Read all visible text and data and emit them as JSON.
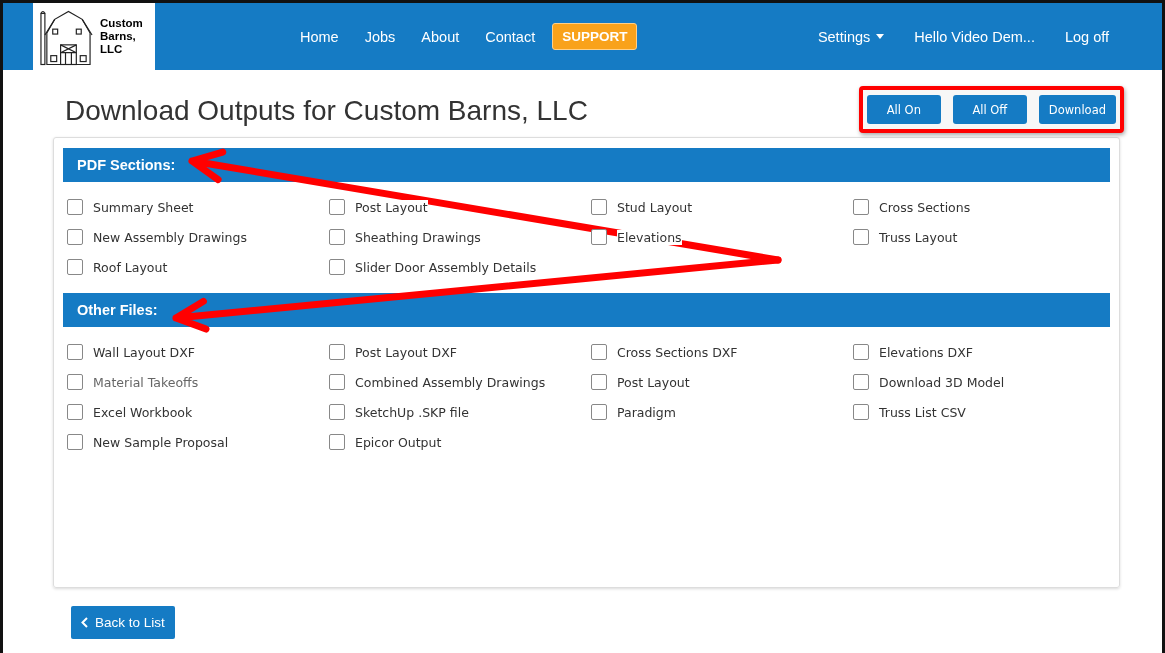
{
  "logo": {
    "text": "Custom Barns, LLC"
  },
  "nav": {
    "links": [
      {
        "label": "Home",
        "kind": "link"
      },
      {
        "label": "Jobs",
        "kind": "link"
      },
      {
        "label": "About",
        "kind": "link"
      },
      {
        "label": "Contact",
        "kind": "link"
      },
      {
        "label": "SUPPORT",
        "kind": "highlight"
      }
    ],
    "right": [
      {
        "label": "Settings",
        "kind": "dropdown"
      },
      {
        "label": "Hello Video Dem...",
        "kind": "link"
      },
      {
        "label": "Log off",
        "kind": "link"
      }
    ]
  },
  "title": "Download Outputs for Custom Barns, LLC",
  "actions": [
    "All On",
    "All Off",
    "Download"
  ],
  "sections": [
    {
      "title": "PDF Sections:",
      "items": [
        {
          "label": "Summary Sheet",
          "checked": false,
          "disabled": false
        },
        {
          "label": "Post Layout",
          "checked": false,
          "disabled": false
        },
        {
          "label": "Stud Layout",
          "checked": false,
          "disabled": false
        },
        {
          "label": "Cross Sections",
          "checked": false,
          "disabled": false
        },
        {
          "label": "New Assembly Drawings",
          "checked": false,
          "disabled": false
        },
        {
          "label": "Sheathing Drawings",
          "checked": false,
          "disabled": false
        },
        {
          "label": "Elevations",
          "checked": false,
          "disabled": false
        },
        {
          "label": "Truss Layout",
          "checked": false,
          "disabled": false
        },
        {
          "label": "Roof Layout",
          "checked": false,
          "disabled": false
        },
        {
          "label": "Slider Door Assembly Details",
          "checked": false,
          "disabled": false
        }
      ]
    },
    {
      "title": "Other Files:",
      "items": [
        {
          "label": "Wall Layout DXF",
          "checked": false,
          "disabled": false
        },
        {
          "label": "Post Layout DXF",
          "checked": false,
          "disabled": false
        },
        {
          "label": "Cross Sections DXF",
          "checked": false,
          "disabled": false
        },
        {
          "label": "Elevations DXF",
          "checked": false,
          "disabled": false
        },
        {
          "label": "Material Takeoffs",
          "checked": false,
          "disabled": true
        },
        {
          "label": "Combined Assembly Drawings",
          "checked": false,
          "disabled": false
        },
        {
          "label": "Post Layout",
          "checked": false,
          "disabled": false
        },
        {
          "label": "Download 3D Model",
          "checked": false,
          "disabled": false
        },
        {
          "label": "Excel Workbook",
          "checked": false,
          "disabled": false
        },
        {
          "label": "SketchUp .SKP file",
          "checked": false,
          "disabled": false
        },
        {
          "label": "Paradigm",
          "checked": false,
          "disabled": false
        },
        {
          "label": "Truss List CSV",
          "checked": false,
          "disabled": false
        },
        {
          "label": "New Sample Proposal",
          "checked": false,
          "disabled": false
        },
        {
          "label": "Epicor Output",
          "checked": false,
          "disabled": false
        }
      ]
    }
  ],
  "back": "Back to List"
}
